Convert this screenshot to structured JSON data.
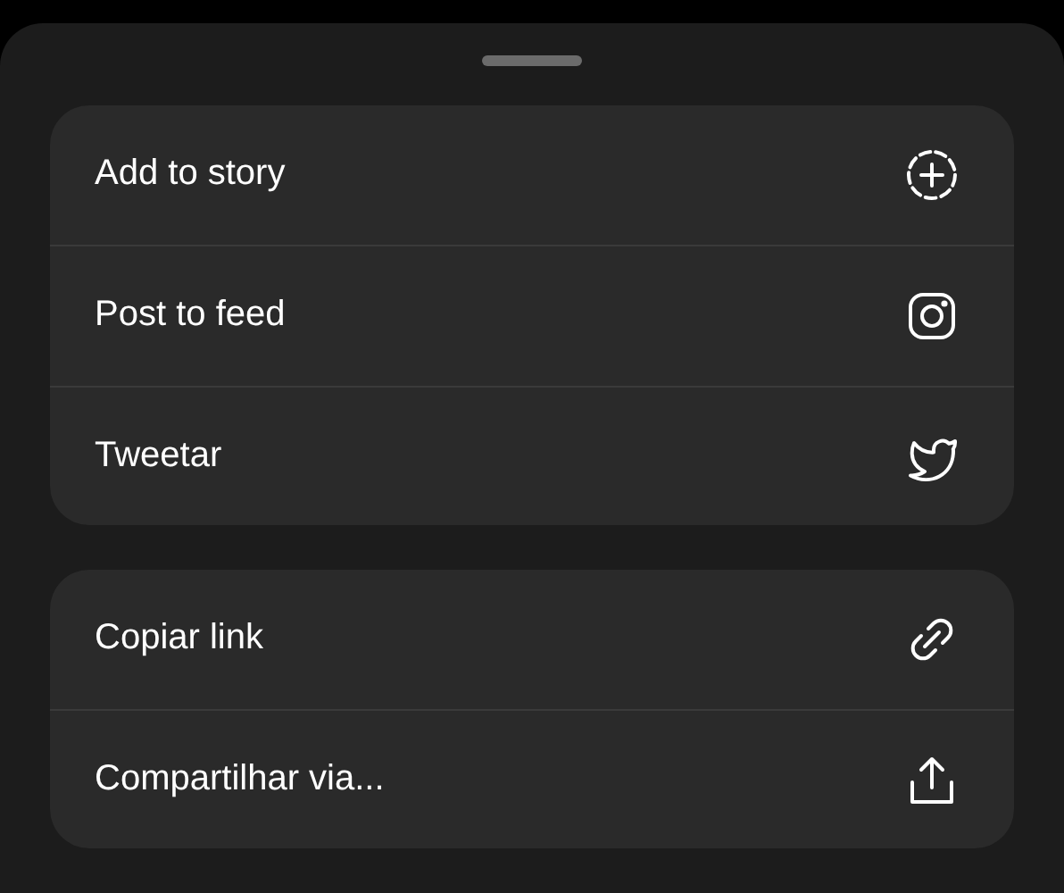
{
  "sheet": {
    "groups": [
      {
        "items": [
          {
            "label": "Add to story",
            "kind": "story"
          },
          {
            "label": "Post to feed",
            "kind": "feed"
          },
          {
            "label": "Tweetar",
            "kind": "tweet"
          }
        ]
      },
      {
        "items": [
          {
            "label": "Copiar link",
            "kind": "link"
          },
          {
            "label": "Compartilhar via...",
            "kind": "share"
          }
        ]
      }
    ]
  }
}
